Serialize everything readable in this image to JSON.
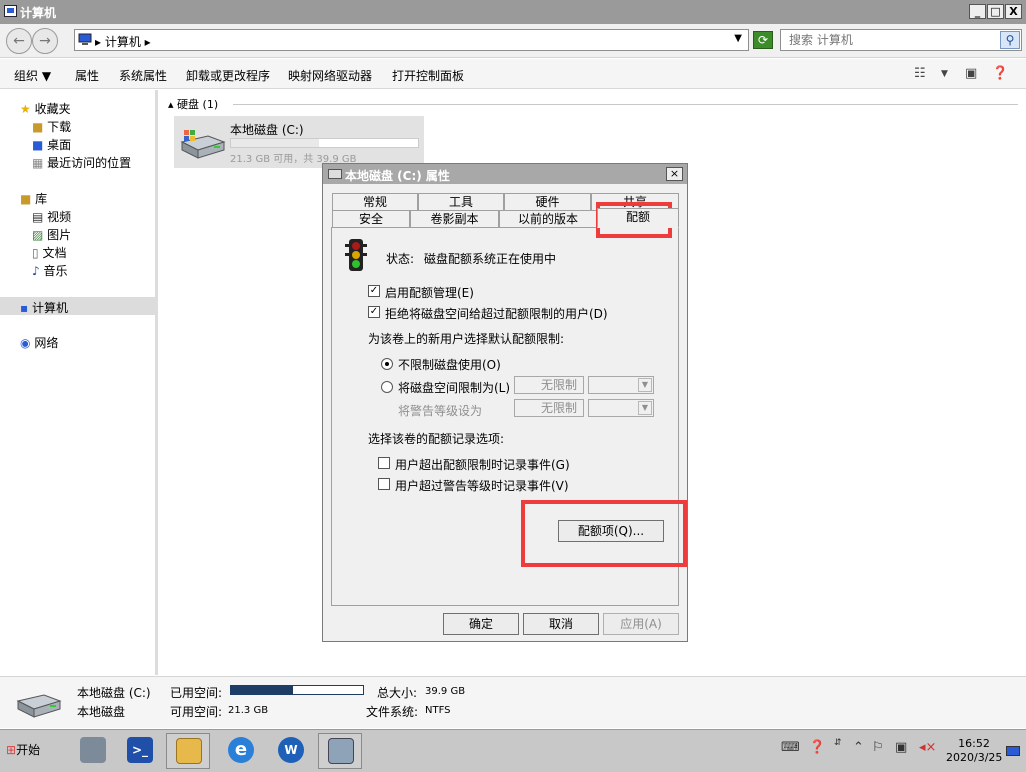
{
  "window": {
    "title": "计算机",
    "minimize": "_",
    "restore": "□",
    "close": "X"
  },
  "address": {
    "crumb": "计算机",
    "search_placeholder": "搜索 计算机"
  },
  "toolbar": {
    "organize": "组织",
    "items": [
      "属性",
      "系统属性",
      "卸载或更改程序",
      "映射网络驱动器",
      "打开控制面板"
    ]
  },
  "nav": {
    "favorites": "收藏夹",
    "downloads": "下载",
    "desktop": "桌面",
    "recent": "最近访问的位置",
    "libraries": "库",
    "videos": "视频",
    "pictures": "图片",
    "documents": "文档",
    "music": "音乐",
    "computer": "计算机",
    "network": "网络"
  },
  "main": {
    "group_header": "硬盘 (1)",
    "drive_name": "本地磁盘 (C:)",
    "drive_info": "21.3 GB 可用，共 39.9 GB",
    "drive_used_fraction": 0.47
  },
  "dialog": {
    "title": "本地磁盘 (C:) 属性",
    "close": "×",
    "tabs_row1": [
      "常规",
      "工具",
      "硬件",
      "共享"
    ],
    "tabs_row2": [
      "安全",
      "卷影副本",
      "以前的版本",
      "配额"
    ],
    "status_label": "状态:",
    "status_text": "磁盘配额系统正在使用中",
    "enable_quota": "启用配额管理(E)",
    "deny_space": "拒绝将磁盘空间给超过配额限制的用户(D)",
    "default_limit_label": "为该卷上的新用户选择默认配额限制:",
    "no_limit": "不限制磁盘使用(O)",
    "limit_to": "将磁盘空间限制为(L)",
    "limit_value": "无限制",
    "warn_level": "将警告等级设为",
    "warn_value": "无限制",
    "log_options_label": "选择该卷的配额记录选项:",
    "log_over_limit": "用户超出配额限制时记录事件(G)",
    "log_over_warn": "用户超过警告等级时记录事件(V)",
    "quota_entries": "配额项(Q)...",
    "ok": "确定",
    "cancel": "取消",
    "apply": "应用(A)",
    "check_mark": "✓"
  },
  "details": {
    "name": "本地磁盘 (C:)",
    "type": "本地磁盘",
    "used_label": "已用空间:",
    "free_label": "可用空间:",
    "free_value": "21.3 GB",
    "total_label": "总大小:",
    "total_value": "39.9 GB",
    "fs_label": "文件系统:",
    "fs_value": "NTFS",
    "used_fraction": 0.47
  },
  "taskbar": {
    "start": "开始",
    "time": "16:52",
    "date": "2020/3/25"
  },
  "colors": {
    "highlight": "#ee3b3b",
    "used_bar": "#1d3c66"
  }
}
